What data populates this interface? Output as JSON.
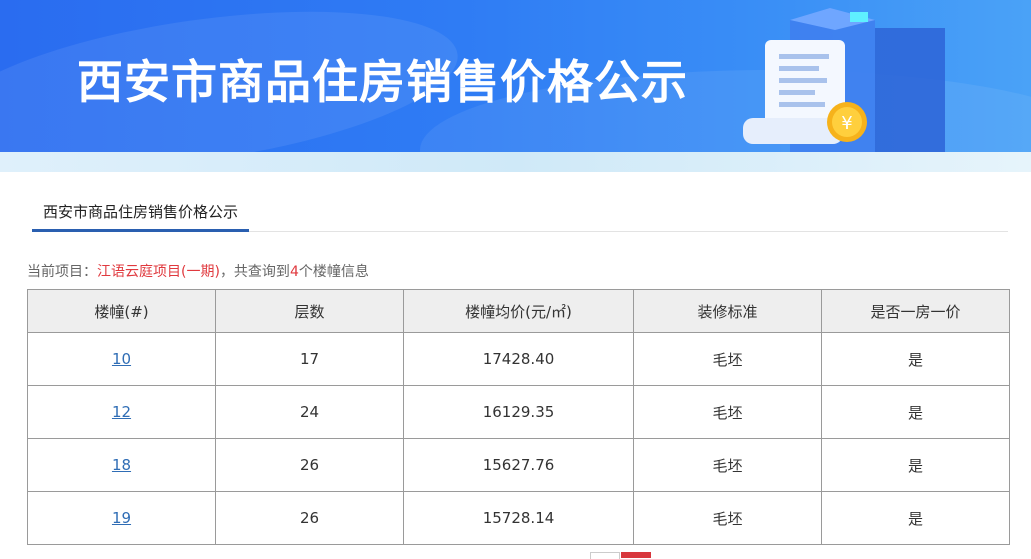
{
  "banner": {
    "title": "西安市商品住房销售价格公示"
  },
  "tab": {
    "label": "西安市商品住房销售价格公示"
  },
  "summary": {
    "prefix": "当前项目：",
    "project": "江语云庭项目(一期)",
    "mid": "，共查询到",
    "count": "4",
    "suffix": "个楼幢信息"
  },
  "table": {
    "headers": [
      "楼幢(#)",
      "层数",
      "楼幢均价(元/㎡)",
      "装修标准",
      "是否一房一价"
    ],
    "rows": [
      {
        "building": "10",
        "floors": "17",
        "price": "17428.40",
        "decoration": "毛坯",
        "one_price": "是"
      },
      {
        "building": "12",
        "floors": "24",
        "price": "16129.35",
        "decoration": "毛坯",
        "one_price": "是"
      },
      {
        "building": "18",
        "floors": "26",
        "price": "15627.76",
        "decoration": "毛坯",
        "one_price": "是"
      },
      {
        "building": "19",
        "floors": "26",
        "price": "15728.14",
        "decoration": "毛坯",
        "one_price": "是"
      }
    ]
  },
  "colors": {
    "accent": "#2a5fb0",
    "highlight": "#e0393e",
    "link": "#2f6db5",
    "banner": "#2f7cf4"
  }
}
